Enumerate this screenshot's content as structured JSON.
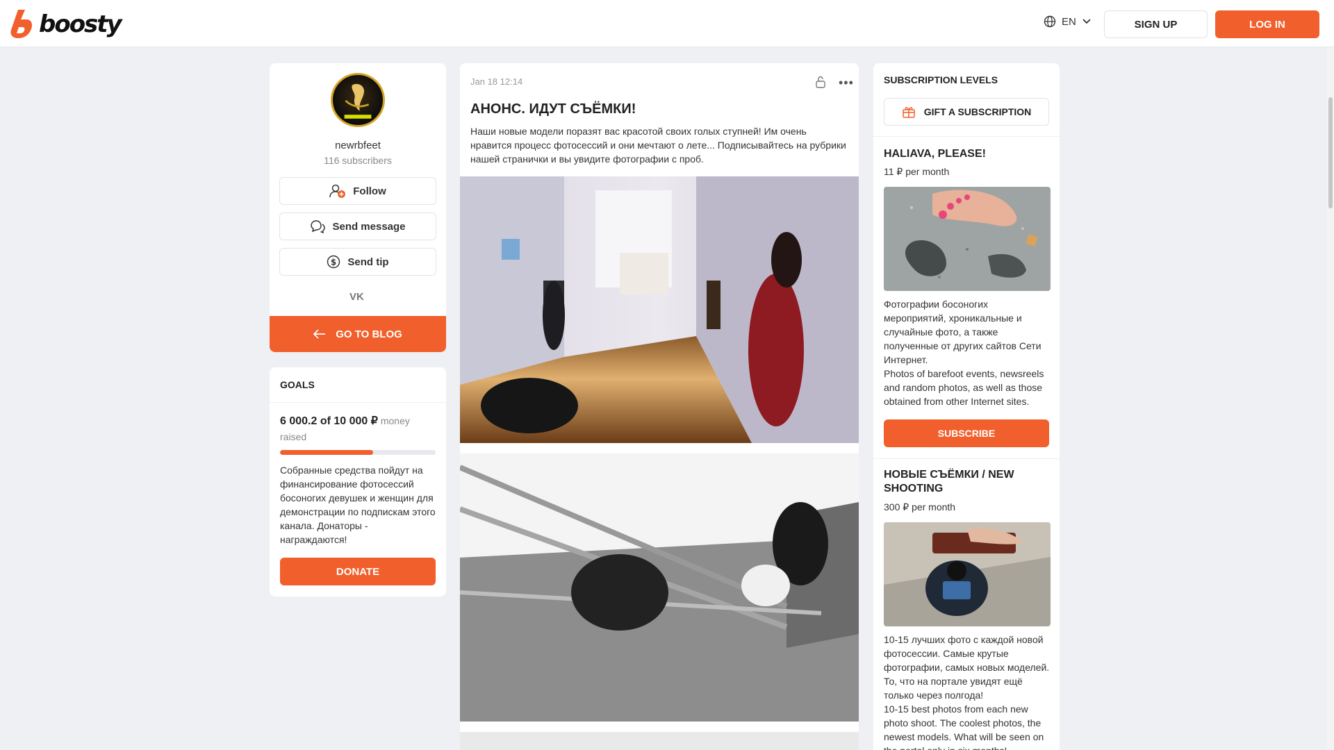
{
  "header": {
    "logo_text": "boosty",
    "lang": "EN",
    "signup_label": "SIGN UP",
    "login_label": "LOG IN"
  },
  "profile": {
    "username": "newrbfeet",
    "subscribers": "116 subscribers",
    "follow_label": "Follow",
    "message_label": "Send message",
    "tip_label": "Send tip",
    "social": "VK",
    "go_to_blog_label": "GO TO BLOG"
  },
  "goals": {
    "title": "GOALS",
    "amount": "6 000.2 of 10 000 ₽",
    "amount_suffix": "money raised",
    "progress": 0.60002,
    "description": "Собранные средства пойдут на финансирование фотосессий босоногих девушек и женщин для демонстрации по подпискам этого канала. Донаторы - награждаются!",
    "donate_label": "DONATE"
  },
  "post": {
    "date": "Jan 18 12:14",
    "title": "АНОНС. ИДУТ СЪЁМКИ!",
    "text": "Наши новые модели поразят вас красотой своих голых ступней! Им очень нравится процесс фотосессий и они мечтают о лете... Подписывайтесь на рубрики нашей странички и вы увидите фотографии с проб."
  },
  "subscriptions": {
    "title": "SUBSCRIPTION LEVELS",
    "gift_label": "GIFT A SUBSCRIPTION",
    "tiers": [
      {
        "name": "HALIAVA, PLEASE!",
        "price": "11 ₽ per month",
        "description": "Фотографии босоногих мероприятий, хроникальные и случайные фото, а также полученные от других сайтов Сети Интернет.\nPhotos of barefoot events, newsreels and random photos, as well as those obtained from other Internet sites.",
        "subscribe_label": "SUBSCRIBE"
      },
      {
        "name": "НОВЫЕ СЪЁМКИ / NEW SHOOTING",
        "price": "300 ₽ per month",
        "description": "10-15 лучших фото с каждой новой фотосессии. Самые крутые фотографии, самых новых моделей. То, что на портале увидят ещё только через полгода!\n10-15 best photos from each new photo shoot. The coolest photos, the newest models. What will be seen on the portal only in six months!"
      }
    ]
  },
  "colors": {
    "accent": "#f15f2c",
    "background": "#eef0f3"
  }
}
